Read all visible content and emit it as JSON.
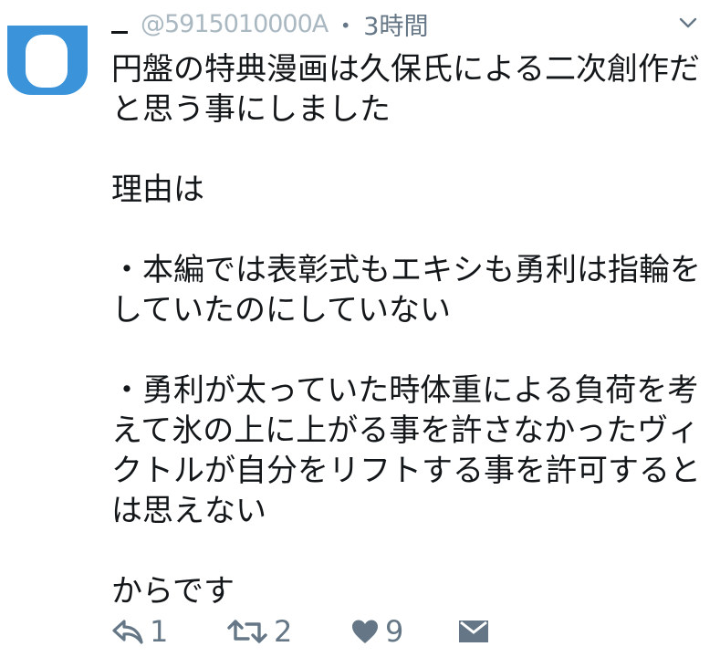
{
  "tweet": {
    "handle": "@5915010000A",
    "separator": "・",
    "time": "3時間",
    "lines": [
      "円盤の特典漫画は久保氏による二次創作だ",
      "と思う事にしました",
      "",
      "理由は",
      "",
      "・本編では表彰式もエキシも勇利は指輪を",
      "していたのにしていない",
      "",
      "・勇利が太っていた時体重による負荷を考",
      "えて氷の上に上がる事を許さなかったヴィ",
      "クトルが自分をリフトする事を許可すると",
      "は思えない",
      "",
      "からです"
    ]
  },
  "actions": {
    "reply": {
      "icon": "reply-icon",
      "count": "1"
    },
    "retweet": {
      "icon": "retweet-icon",
      "count": "2"
    },
    "like": {
      "icon": "heart-icon",
      "count": "9"
    },
    "dm": {
      "icon": "envelope-icon"
    }
  },
  "colors": {
    "text": "#14171a",
    "secondary": "#657786",
    "avatar": "#3b94d9"
  }
}
